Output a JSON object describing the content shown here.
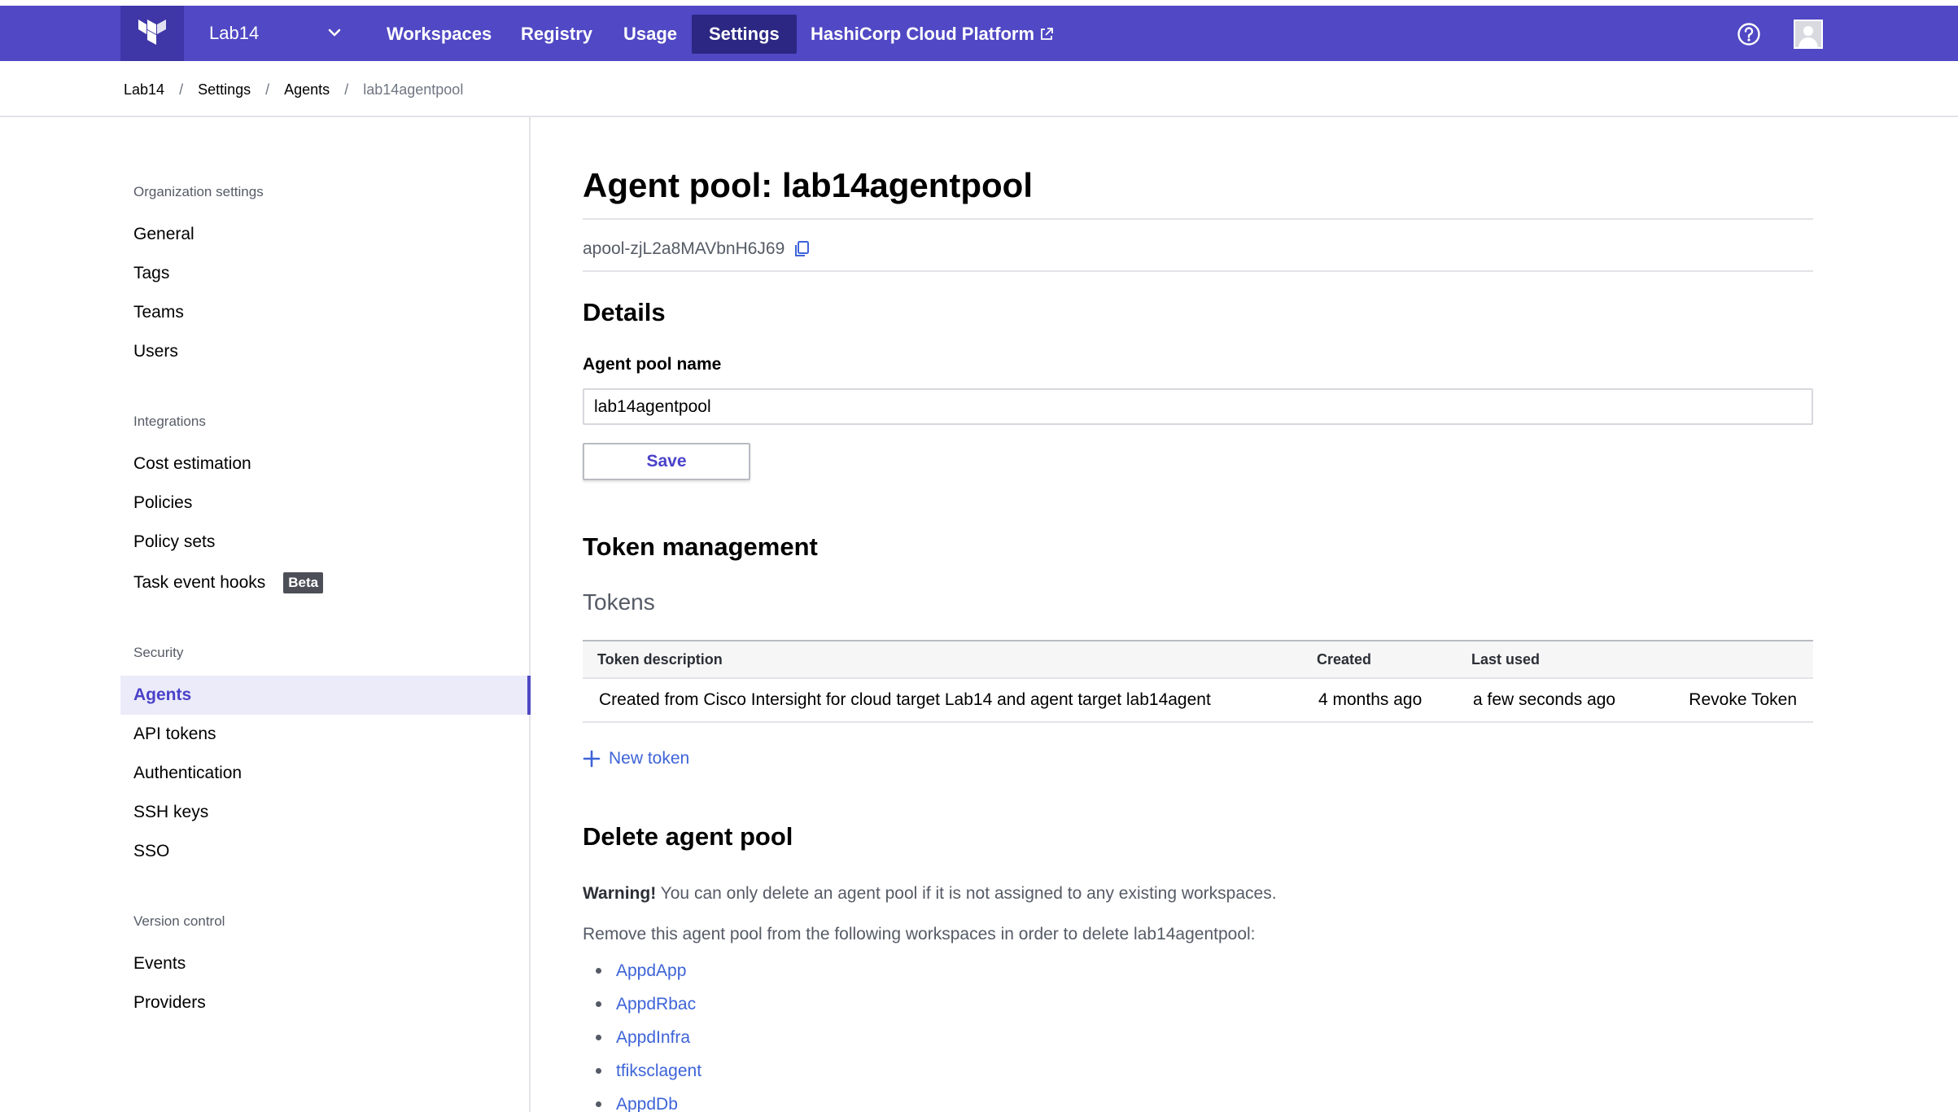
{
  "topnav": {
    "org": "Lab14",
    "items": [
      {
        "label": "Workspaces"
      },
      {
        "label": "Registry"
      },
      {
        "label": "Usage"
      },
      {
        "label": "Settings"
      },
      {
        "label": "HashiCorp Cloud Platform"
      }
    ],
    "active": "Settings",
    "brand_color": "#5048c4",
    "active_color": "#2b2783"
  },
  "breadcrumb": {
    "items": [
      "Lab14",
      "Settings",
      "Agents"
    ],
    "current": "lab14agentpool",
    "separator": "/"
  },
  "sidebar": {
    "sections": [
      {
        "heading": "Organization settings",
        "items": [
          "General",
          "Tags",
          "Teams",
          "Users"
        ]
      },
      {
        "heading": "Integrations",
        "items": [
          "Cost estimation",
          "Policies",
          "Policy sets",
          "Task event hooks"
        ]
      },
      {
        "heading": "Security",
        "items": [
          "Agents",
          "API tokens",
          "Authentication",
          "SSH keys",
          "SSO"
        ]
      },
      {
        "heading": "Version control",
        "items": [
          "Events",
          "Providers"
        ]
      }
    ],
    "beta_badge": "Beta",
    "active_item": "Agents"
  },
  "main": {
    "title": "Agent pool: lab14agentpool",
    "pool_id": "apool-zjL2a8MAVbnH6J69",
    "details_heading": "Details",
    "name_label": "Agent pool name",
    "name_value": "lab14agentpool",
    "save_label": "Save",
    "token_heading": "Token management",
    "tokens_label": "Tokens",
    "table": {
      "headers": [
        "Token description",
        "Created",
        "Last used"
      ],
      "rows": [
        {
          "description": "Created from Cisco Intersight for cloud target Lab14 and agent target lab14agent",
          "created": "4 months ago",
          "last_used": "a few seconds ago",
          "action": "Revoke Token"
        }
      ]
    },
    "new_token": "New token",
    "delete_heading": "Delete agent pool",
    "warning_strong": "Warning!",
    "warning_text": " You can only delete an agent pool if it is not assigned to any existing workspaces.",
    "remove_text": "Remove this agent pool from the following workspaces in order to delete lab14agentpool:",
    "workspaces": [
      "AppdApp",
      "AppdRbac",
      "AppdInfra",
      "tfiksclagent",
      "AppdDb"
    ]
  }
}
